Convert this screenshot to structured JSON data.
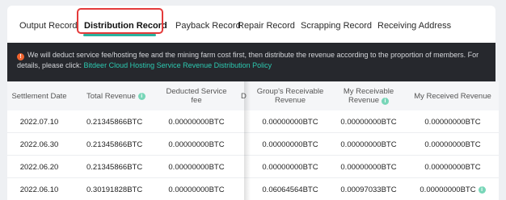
{
  "tabs": [
    {
      "label": "Output Record"
    },
    {
      "label": "Distribution Record"
    },
    {
      "label": "Payback Record"
    },
    {
      "label": "Repair Record"
    },
    {
      "label": "Scrapping Record"
    },
    {
      "label": "Receiving Address"
    }
  ],
  "notice": {
    "icon": "warning-icon",
    "text": "We will deduct service fee/hosting fee and the mining farm cost first, then distribute the revenue according to the proportion of members. For details, please click: ",
    "link": "Bitdeer Cloud Hosting Service Revenue Distribution Policy"
  },
  "table": {
    "headers": {
      "settlement_date": "Settlement Date",
      "total_revenue": "Total Revenue",
      "deducted_fee_line1": "Deducted Service",
      "deducted_fee_line2": "fee",
      "truncated": "D",
      "group_revenue_line1": "Group's Receivable",
      "group_revenue_line2": "Revenue",
      "my_receivable_line1": "My Receivable",
      "my_receivable_line2": "Revenue",
      "my_received": "My Received Revenue"
    },
    "rows": [
      {
        "date": "2022.07.10",
        "total": "0.21345866BTC",
        "fee": "0.00000000BTC",
        "group": "0.00000000BTC",
        "receivable": "0.00000000BTC",
        "received": "0.00000000BTC"
      },
      {
        "date": "2022.06.30",
        "total": "0.21345866BTC",
        "fee": "0.00000000BTC",
        "group": "0.00000000BTC",
        "receivable": "0.00000000BTC",
        "received": "0.00000000BTC"
      },
      {
        "date": "2022.06.20",
        "total": "0.21345866BTC",
        "fee": "0.00000000BTC",
        "group": "0.00000000BTC",
        "receivable": "0.00000000BTC",
        "received": "0.00000000BTC"
      },
      {
        "date": "2022.06.10",
        "total": "0.30191828BTC",
        "fee": "0.00000000BTC",
        "group": "0.06064564BTC",
        "receivable": "0.00097033BTC",
        "received": "0.00000000BTC"
      }
    ]
  },
  "colors": {
    "accent": "#2bb39f",
    "highlight": "#e43a3a",
    "notice_bg": "#26282d",
    "link": "#2cc9b0"
  }
}
